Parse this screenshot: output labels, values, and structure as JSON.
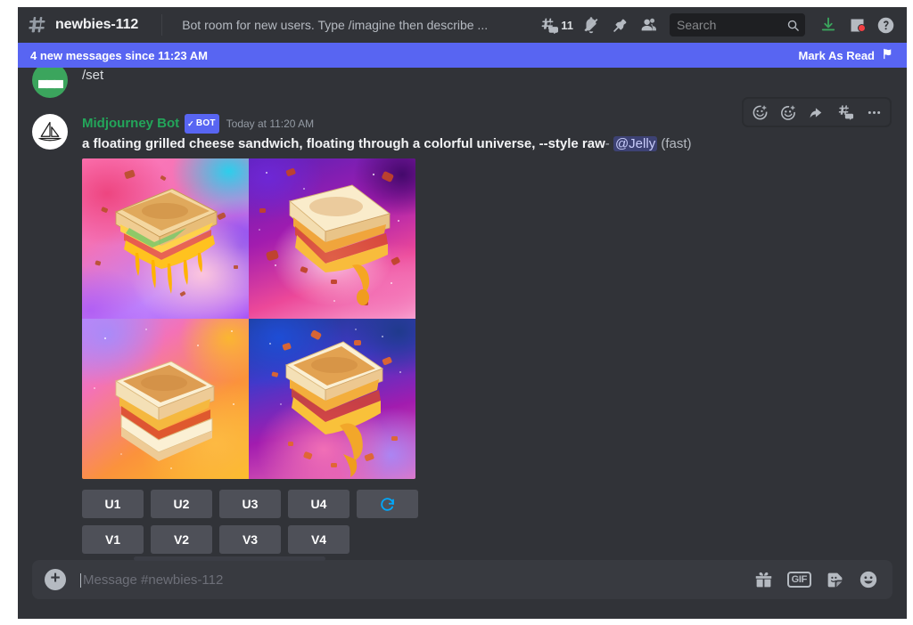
{
  "topbar": {
    "hash_icon": "channel-hash-icon",
    "channel_name": "newbies-112",
    "channel_topic": "Bot room for new users. Type /imagine then describe ...",
    "threads_icon": "threads-icon",
    "threads_count": "11",
    "mute_icon": "notification-muted-icon",
    "pin_icon": "pinned-messages-icon",
    "members_icon": "member-list-icon",
    "search_placeholder": "Search",
    "search_icon": "search-icon",
    "inbox_icon": "inbox-icon",
    "download_icon": "download-icon",
    "help_icon": "help-icon"
  },
  "banner": {
    "text": "4 new messages since 11:23 AM",
    "mark_as_read": "Mark As Read",
    "mark_icon": "mark-read-flag-icon"
  },
  "previous_message": {
    "text": "/set",
    "avatar": "user-avatar"
  },
  "message": {
    "avatar": "midjourney-sailboat-avatar",
    "author": "Midjourney Bot",
    "bot_tag": "BOT",
    "bot_check": "✓",
    "timestamp": "Today at 11:20 AM",
    "prompt": "a floating grilled cheese sandwich, floating through a colorful universe, --style raw",
    "separator": "-",
    "mention": "@Jelly",
    "speed": "(fast)",
    "toolbar": [
      {
        "name": "add-reaction-icon",
        "glyph": "☺"
      },
      {
        "name": "add-super-reaction-icon",
        "glyph": "☻"
      },
      {
        "name": "reply-icon",
        "glyph": "↩"
      },
      {
        "name": "create-thread-icon",
        "glyph": "#"
      },
      {
        "name": "more-actions-icon",
        "glyph": "⋯"
      }
    ]
  },
  "image_grid": {
    "alt": "four generated grilled cheese sandwich images",
    "tiles": [
      {
        "name": "generated-image-1",
        "position": "top-left"
      },
      {
        "name": "generated-image-2",
        "position": "top-right"
      },
      {
        "name": "generated-image-3",
        "position": "bottom-left"
      },
      {
        "name": "generated-image-4",
        "position": "bottom-right"
      }
    ]
  },
  "actions": {
    "upscale_row": [
      "U1",
      "U2",
      "U3",
      "U4"
    ],
    "reroll_icon": "reroll-refresh-icon",
    "reroll_glyph": "⟳",
    "variation_row": [
      "V1",
      "V2",
      "V3",
      "V4"
    ],
    "accent_color": "#00a8fc"
  },
  "composer": {
    "add_icon": "add-attachment-icon",
    "add_glyph": "+",
    "placeholder": "Message #newbies-112",
    "gift_icon": "gift-icon",
    "gif_icon": "gif-icon",
    "gif_label": "GIF",
    "sticker_icon": "sticker-icon",
    "emoji_icon": "emoji-icon"
  },
  "colors": {
    "brand": "#5865f2",
    "background": "#313338",
    "author_green": "#23a55a",
    "accent_blue": "#00a8fc",
    "danger_red": "#f23f43",
    "download_green": "#3ba55d"
  }
}
